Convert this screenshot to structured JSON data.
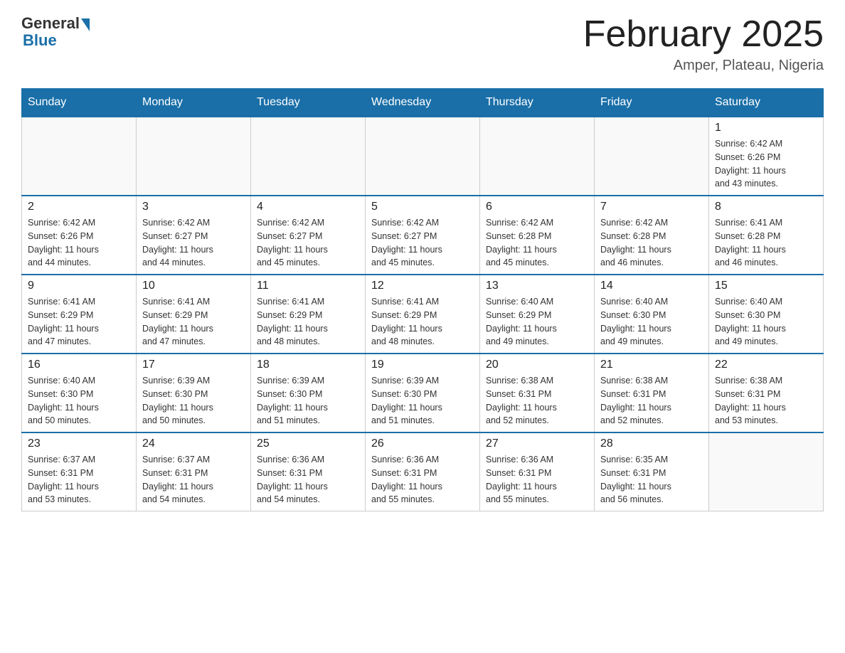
{
  "logo": {
    "general": "General",
    "blue": "Blue"
  },
  "title": "February 2025",
  "location": "Amper, Plateau, Nigeria",
  "days_of_week": [
    "Sunday",
    "Monday",
    "Tuesday",
    "Wednesday",
    "Thursday",
    "Friday",
    "Saturday"
  ],
  "weeks": [
    [
      {
        "day": "",
        "info": ""
      },
      {
        "day": "",
        "info": ""
      },
      {
        "day": "",
        "info": ""
      },
      {
        "day": "",
        "info": ""
      },
      {
        "day": "",
        "info": ""
      },
      {
        "day": "",
        "info": ""
      },
      {
        "day": "1",
        "info": "Sunrise: 6:42 AM\nSunset: 6:26 PM\nDaylight: 11 hours\nand 43 minutes."
      }
    ],
    [
      {
        "day": "2",
        "info": "Sunrise: 6:42 AM\nSunset: 6:26 PM\nDaylight: 11 hours\nand 44 minutes."
      },
      {
        "day": "3",
        "info": "Sunrise: 6:42 AM\nSunset: 6:27 PM\nDaylight: 11 hours\nand 44 minutes."
      },
      {
        "day": "4",
        "info": "Sunrise: 6:42 AM\nSunset: 6:27 PM\nDaylight: 11 hours\nand 45 minutes."
      },
      {
        "day": "5",
        "info": "Sunrise: 6:42 AM\nSunset: 6:27 PM\nDaylight: 11 hours\nand 45 minutes."
      },
      {
        "day": "6",
        "info": "Sunrise: 6:42 AM\nSunset: 6:28 PM\nDaylight: 11 hours\nand 45 minutes."
      },
      {
        "day": "7",
        "info": "Sunrise: 6:42 AM\nSunset: 6:28 PM\nDaylight: 11 hours\nand 46 minutes."
      },
      {
        "day": "8",
        "info": "Sunrise: 6:41 AM\nSunset: 6:28 PM\nDaylight: 11 hours\nand 46 minutes."
      }
    ],
    [
      {
        "day": "9",
        "info": "Sunrise: 6:41 AM\nSunset: 6:29 PM\nDaylight: 11 hours\nand 47 minutes."
      },
      {
        "day": "10",
        "info": "Sunrise: 6:41 AM\nSunset: 6:29 PM\nDaylight: 11 hours\nand 47 minutes."
      },
      {
        "day": "11",
        "info": "Sunrise: 6:41 AM\nSunset: 6:29 PM\nDaylight: 11 hours\nand 48 minutes."
      },
      {
        "day": "12",
        "info": "Sunrise: 6:41 AM\nSunset: 6:29 PM\nDaylight: 11 hours\nand 48 minutes."
      },
      {
        "day": "13",
        "info": "Sunrise: 6:40 AM\nSunset: 6:29 PM\nDaylight: 11 hours\nand 49 minutes."
      },
      {
        "day": "14",
        "info": "Sunrise: 6:40 AM\nSunset: 6:30 PM\nDaylight: 11 hours\nand 49 minutes."
      },
      {
        "day": "15",
        "info": "Sunrise: 6:40 AM\nSunset: 6:30 PM\nDaylight: 11 hours\nand 49 minutes."
      }
    ],
    [
      {
        "day": "16",
        "info": "Sunrise: 6:40 AM\nSunset: 6:30 PM\nDaylight: 11 hours\nand 50 minutes."
      },
      {
        "day": "17",
        "info": "Sunrise: 6:39 AM\nSunset: 6:30 PM\nDaylight: 11 hours\nand 50 minutes."
      },
      {
        "day": "18",
        "info": "Sunrise: 6:39 AM\nSunset: 6:30 PM\nDaylight: 11 hours\nand 51 minutes."
      },
      {
        "day": "19",
        "info": "Sunrise: 6:39 AM\nSunset: 6:30 PM\nDaylight: 11 hours\nand 51 minutes."
      },
      {
        "day": "20",
        "info": "Sunrise: 6:38 AM\nSunset: 6:31 PM\nDaylight: 11 hours\nand 52 minutes."
      },
      {
        "day": "21",
        "info": "Sunrise: 6:38 AM\nSunset: 6:31 PM\nDaylight: 11 hours\nand 52 minutes."
      },
      {
        "day": "22",
        "info": "Sunrise: 6:38 AM\nSunset: 6:31 PM\nDaylight: 11 hours\nand 53 minutes."
      }
    ],
    [
      {
        "day": "23",
        "info": "Sunrise: 6:37 AM\nSunset: 6:31 PM\nDaylight: 11 hours\nand 53 minutes."
      },
      {
        "day": "24",
        "info": "Sunrise: 6:37 AM\nSunset: 6:31 PM\nDaylight: 11 hours\nand 54 minutes."
      },
      {
        "day": "25",
        "info": "Sunrise: 6:36 AM\nSunset: 6:31 PM\nDaylight: 11 hours\nand 54 minutes."
      },
      {
        "day": "26",
        "info": "Sunrise: 6:36 AM\nSunset: 6:31 PM\nDaylight: 11 hours\nand 55 minutes."
      },
      {
        "day": "27",
        "info": "Sunrise: 6:36 AM\nSunset: 6:31 PM\nDaylight: 11 hours\nand 55 minutes."
      },
      {
        "day": "28",
        "info": "Sunrise: 6:35 AM\nSunset: 6:31 PM\nDaylight: 11 hours\nand 56 minutes."
      },
      {
        "day": "",
        "info": ""
      }
    ]
  ]
}
